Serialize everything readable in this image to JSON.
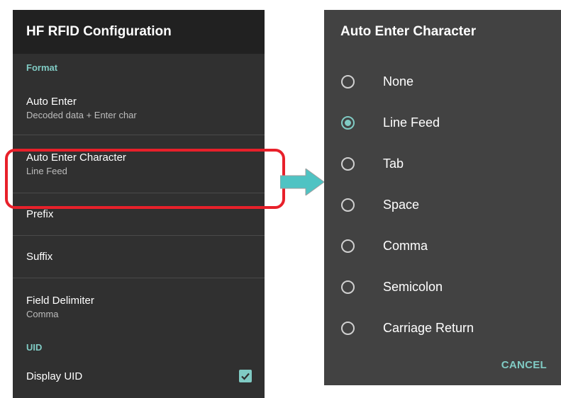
{
  "left": {
    "toolbar_title": "HF RFID Configuration",
    "section_format": "Format",
    "auto_enter": {
      "title": "Auto Enter",
      "summary": "Decoded data + Enter char"
    },
    "auto_enter_character": {
      "title": "Auto Enter Character",
      "summary": "Line Feed"
    },
    "prefix": {
      "title": "Prefix"
    },
    "suffix": {
      "title": "Suffix"
    },
    "field_delimiter": {
      "title": "Field Delimiter",
      "summary": "Comma"
    },
    "section_uid": "UID",
    "display_uid": {
      "title": "Display UID",
      "checked": true
    }
  },
  "dialog": {
    "title": "Auto Enter Character",
    "options": [
      "None",
      "Line Feed",
      "Tab",
      "Space",
      "Comma",
      "Semicolon",
      "Carriage Return"
    ],
    "selected": "Line Feed",
    "cancel_label": "CANCEL"
  },
  "colors": {
    "accent": "#80cbc4",
    "highlight": "#e8202a",
    "arrow": "#4fc3c3"
  }
}
